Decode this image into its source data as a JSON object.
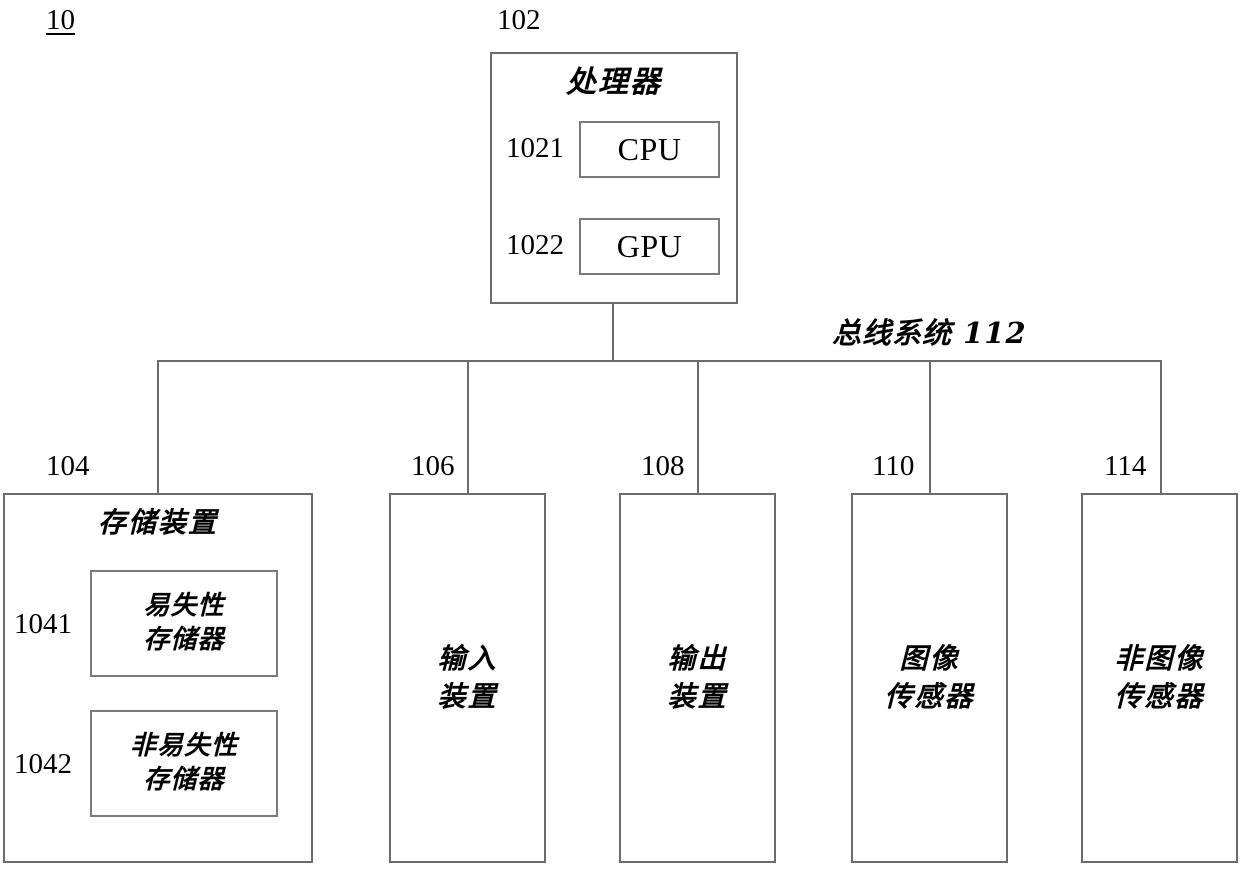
{
  "figure": {
    "figure_ref": "10",
    "processor_ref": "102",
    "bus_label": "总线系统 112"
  },
  "processor": {
    "title": "处理器",
    "cpu": {
      "ref": "1021",
      "label": "CPU"
    },
    "gpu": {
      "ref": "1022",
      "label": "GPU"
    }
  },
  "storage": {
    "ref": "104",
    "title": "存储装置",
    "volatile": {
      "ref": "1041",
      "label": "易失性\n存储器"
    },
    "nonvolatile": {
      "ref": "1042",
      "label": "非易失性\n存储器"
    }
  },
  "peripherals": [
    {
      "ref": "106",
      "label": "输入\n装置"
    },
    {
      "ref": "108",
      "label": "输出\n装置"
    },
    {
      "ref": "110",
      "label": "图像\n传感器"
    },
    {
      "ref": "114",
      "label": "非图像\n传感器"
    }
  ]
}
